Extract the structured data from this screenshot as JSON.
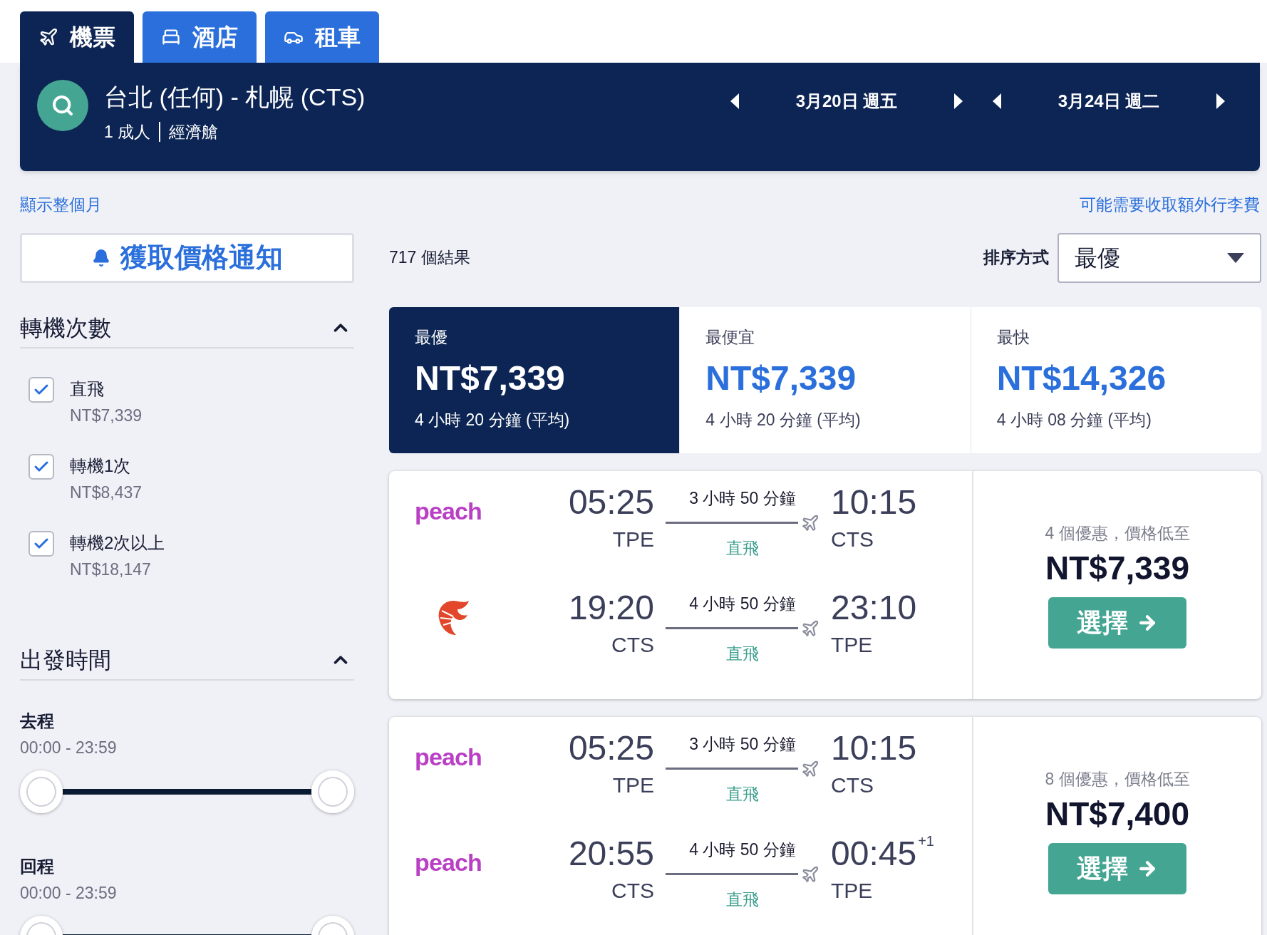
{
  "tabs": [
    {
      "kind": "plane",
      "label": "機票",
      "selected": true
    },
    {
      "kind": "bed",
      "label": "酒店",
      "selected": false
    },
    {
      "kind": "car",
      "label": "租車",
      "selected": false
    }
  ],
  "search": {
    "route": "台北 (任何) - 札幌 (CTS)",
    "passengers": "1 成人",
    "cabin": "經濟艙",
    "dates": [
      "3月20日 週五",
      "3月24日 週二"
    ]
  },
  "month_link": "顯示整個月",
  "baggage_note": "可能需要收取額外行李費",
  "alert_button": "獲取價格通知",
  "result_count": "717 個結果",
  "sort": {
    "label": "排序方式",
    "value": "最優"
  },
  "stops_filter": {
    "title": "轉機次數",
    "expanded": true,
    "options": [
      {
        "label": "直飛",
        "price": "NT$7,339",
        "checked": true
      },
      {
        "label": "轉機1次",
        "price": "NT$8,437",
        "checked": true
      },
      {
        "label": "轉機2次以上",
        "price": "NT$18,147",
        "checked": true
      }
    ]
  },
  "time_filter": {
    "title": "出發時間",
    "expanded": true,
    "ranges": [
      {
        "label": "去程",
        "range": "00:00 - 23:59",
        "start": {
          "level": 0
        },
        "end": {
          "level": 1
        }
      },
      {
        "label": "回程",
        "range": "00:00 - 23:59",
        "start": {
          "level": 0
        },
        "end": {
          "level": 1
        }
      }
    ]
  },
  "summary_tabs": [
    {
      "label": "最優",
      "price": "NT$7,339",
      "duration": "4 小時 20 分鐘 (平均)",
      "selected": true
    },
    {
      "label": "最便宜",
      "price": "NT$7,339",
      "duration": "4 小時 20 分鐘 (平均)",
      "selected": false
    },
    {
      "label": "最快",
      "price": "NT$14,326",
      "duration": "4 小時 08 分鐘 (平均)",
      "selected": false
    }
  ],
  "results": [
    {
      "legs": [
        {
          "airline": {
            "kind": "wordmark",
            "text": "peach"
          },
          "depart": "05:25",
          "from": "TPE",
          "duration": "3 小時 50 分鐘",
          "stops": "直飛",
          "arrive": "10:15",
          "to": "CTS"
        },
        {
          "airline": {
            "kind": "bird"
          },
          "depart": "19:20",
          "from": "CTS",
          "duration": "4 小時 50 分鐘",
          "stops": "直飛",
          "arrive": "23:10",
          "to": "TPE"
        }
      ],
      "offers": "4 個優惠，價格低至",
      "price": "NT$7,339",
      "button": "選擇"
    },
    {
      "legs": [
        {
          "airline": {
            "kind": "wordmark",
            "text": "peach"
          },
          "depart": "05:25",
          "from": "TPE",
          "duration": "3 小時 50 分鐘",
          "stops": "直飛",
          "arrive": "10:15",
          "to": "CTS"
        },
        {
          "airline": {
            "kind": "wordmark",
            "text": "peach"
          },
          "depart": "20:55",
          "from": "CTS",
          "duration": "4 小時 50 分鐘",
          "stops": "直飛",
          "arrive": "00:45",
          "day_offset": "+1",
          "to": "TPE"
        }
      ],
      "offers": "8 個優惠，價格低至",
      "price": "NT$7,400",
      "button": "選擇"
    }
  ]
}
